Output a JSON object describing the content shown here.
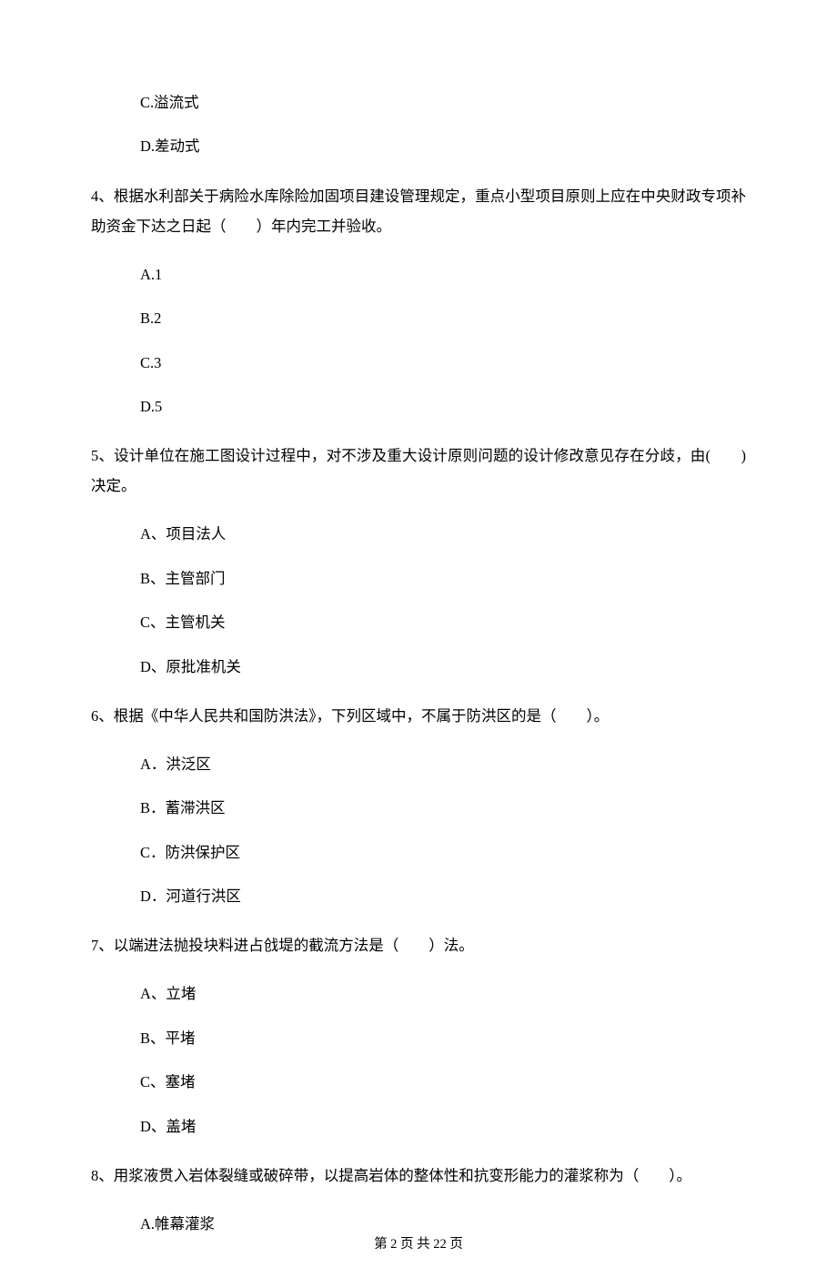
{
  "orphan_options": {
    "c": "C.溢流式",
    "d": "D.差动式"
  },
  "q4": {
    "text": "4、根据水利部关于病险水库除险加固项目建设管理规定，重点小型项目原则上应在中央财政专项补助资金下达之日起（　　）年内完工并验收。",
    "a": "A.1",
    "b": "B.2",
    "c": "C.3",
    "d": "D.5"
  },
  "q5": {
    "text": "5、设计单位在施工图设计过程中，对不涉及重大设计原则问题的设计修改意见存在分歧，由(　　)决定。",
    "a": "A、项目法人",
    "b": "B、主管部门",
    "c": "C、主管机关",
    "d": "D、原批准机关"
  },
  "q6": {
    "text": "6、根据《中华人民共和国防洪法》，下列区域中，不属于防洪区的是（　　）。",
    "a": "A．洪泛区",
    "b": "B．蓄滞洪区",
    "c": "C．防洪保护区",
    "d": "D．河道行洪区"
  },
  "q7": {
    "text": "7、以端进法抛投块料进占戗堤的截流方法是（　　）法。",
    "a": "A、立堵",
    "b": "B、平堵",
    "c": "C、塞堵",
    "d": "D、盖堵"
  },
  "q8": {
    "text": "8、用浆液贯入岩体裂缝或破碎带，以提高岩体的整体性和抗变形能力的灌浆称为（　　）。",
    "a": "A.帷幕灌浆"
  },
  "footer": "第 2 页 共 22 页"
}
